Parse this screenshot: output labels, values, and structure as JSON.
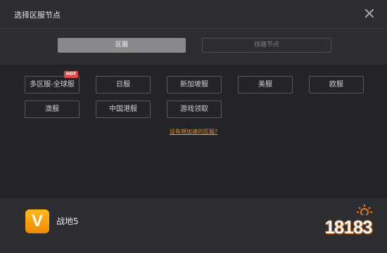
{
  "dialog": {
    "title": "选择区服节点"
  },
  "tabs": [
    {
      "label": "区服",
      "active": true
    },
    {
      "label": "线路节点",
      "active": false
    }
  ],
  "regions": [
    {
      "label": "多区服-全球服",
      "badge": "HOT"
    },
    {
      "label": "日服"
    },
    {
      "label": "新加坡服"
    },
    {
      "label": "美服"
    },
    {
      "label": "欧服"
    },
    {
      "label": "澳服"
    },
    {
      "label": "中国港服"
    },
    {
      "label": "游戏领取"
    }
  ],
  "help_link": "没有想加速的区服?",
  "footer": {
    "app_icon_letter": "V",
    "game_name": "战地5"
  },
  "watermark": {
    "text": "18183"
  },
  "colors": {
    "accent": "#e6932e",
    "hot_badge": "#e04848",
    "app_icon": "#f6a310",
    "tab_active": "#8a8a8c"
  }
}
